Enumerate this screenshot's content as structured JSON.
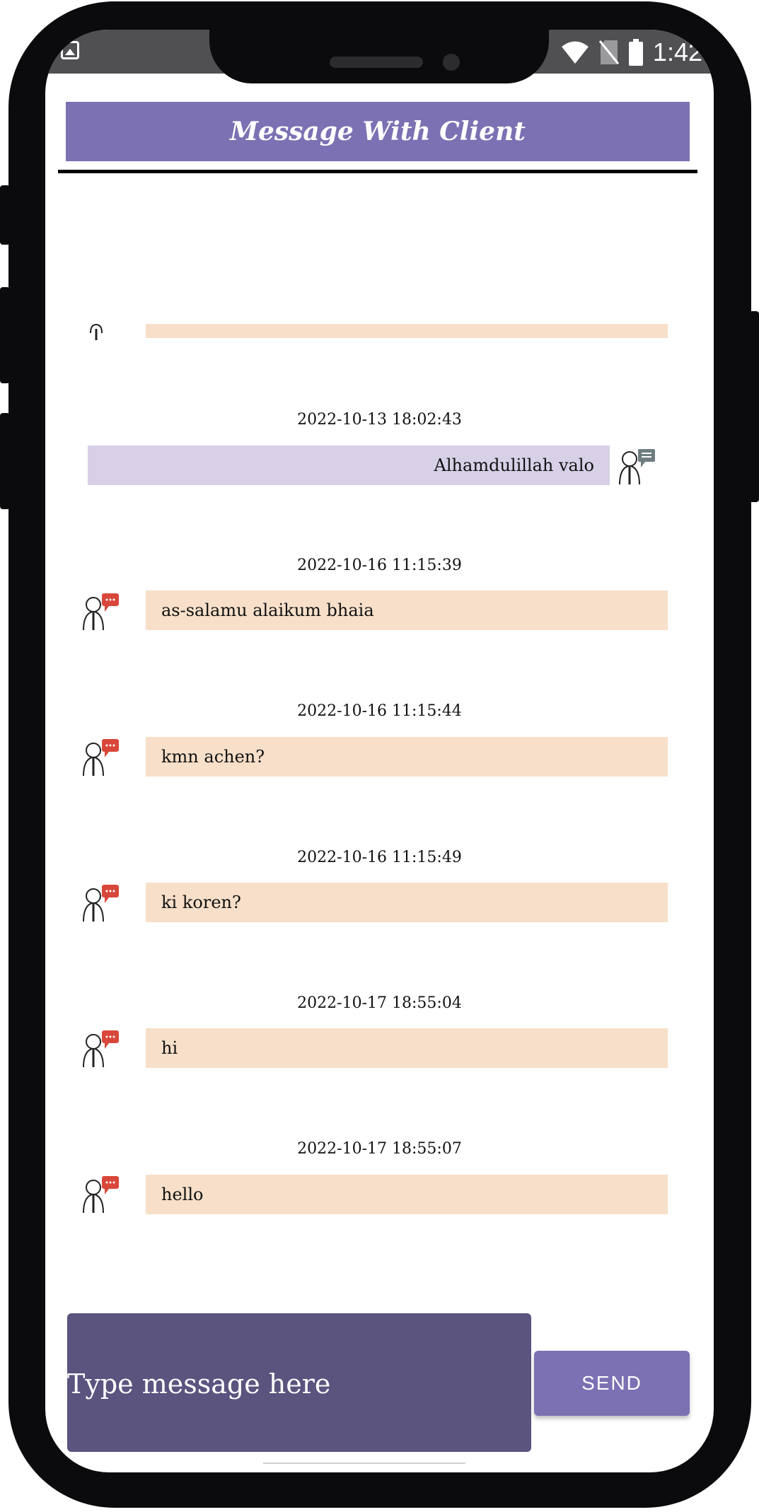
{
  "status_bar": {
    "time": "1:42"
  },
  "app": {
    "title": "Message With Client"
  },
  "messages": [
    {
      "timestamp": "",
      "text": "",
      "direction": "in"
    },
    {
      "timestamp": "2022-10-13 18:02:43",
      "text": "Alhamdulillah valo",
      "direction": "out"
    },
    {
      "timestamp": "2022-10-16 11:15:39",
      "text": "as-salamu alaikum bhaia",
      "direction": "in"
    },
    {
      "timestamp": "2022-10-16 11:15:44",
      "text": "kmn achen?",
      "direction": "in"
    },
    {
      "timestamp": "2022-10-16 11:15:49",
      "text": "ki koren?",
      "direction": "in"
    },
    {
      "timestamp": "2022-10-17 18:55:04",
      "text": "hi",
      "direction": "in"
    },
    {
      "timestamp": "2022-10-17 18:55:07",
      "text": "hello",
      "direction": "in"
    }
  ],
  "composer": {
    "placeholder": "Type message here",
    "value": ""
  },
  "send_button": {
    "label": "SEND"
  },
  "colors": {
    "header": "#7b71b3",
    "incoming_bubble": "#f7dfc9",
    "outgoing_bubble": "#d7d0e7",
    "composer": "#5a547f",
    "incoming_badge": "#d9473b",
    "outgoing_badge": "#6e7d80"
  },
  "icons": {
    "incoming_avatar": "person-with-red-chat-bubble-icon",
    "outgoing_avatar": "person-with-gray-chat-bubble-icon"
  }
}
